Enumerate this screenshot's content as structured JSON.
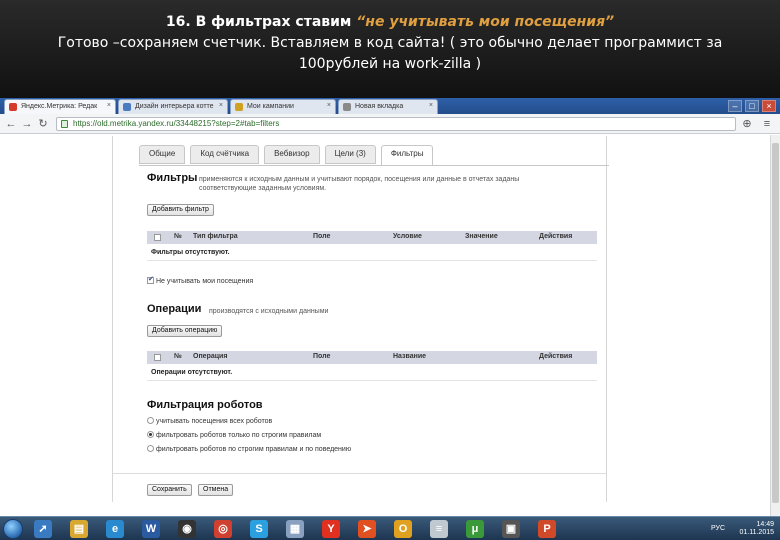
{
  "caption": {
    "line1_pre": "16. В  фильтрах ставим ",
    "line1_accent": "“не учитывать мои посещения”",
    "line2": "Готово –сохраняем счетчик. Вставляем в код сайта! ( это обычно делает программист за",
    "line3": "100рублей на work-zilla )"
  },
  "browser": {
    "tabs": [
      {
        "label": "Яндекс.Метрика: Редак",
        "color": "#d63a2a"
      },
      {
        "label": "Дизайн интерьера котте",
        "color": "#4a7ac0"
      },
      {
        "label": "Мои кампании",
        "color": "#d0a020"
      },
      {
        "label": "Новая вкладка",
        "color": "#8a8a8a"
      }
    ],
    "url": "https://old.metrika.yandex.ru/33448215?step=2#tab=filters",
    "window_buttons": {
      "minimize": "–",
      "maximize": "□",
      "close": "×"
    }
  },
  "page": {
    "tabs": [
      "Общие",
      "Код счётчика",
      "Вебвизор",
      "Цели (3)",
      "Фильтры"
    ],
    "active_tab": "Фильтры",
    "filters": {
      "title": "Фильтры",
      "desc": "применяются к исходным данным и учитывают порядок, посещения или данные в отчетах заданы соответствующие заданным условиям.",
      "add_button": "Добавить фильтр",
      "columns": [
        "№",
        "Тип фильтра",
        "Поле",
        "Условие",
        "Значение",
        "Действия"
      ],
      "empty": "Фильтры отсутствуют."
    },
    "ignore_visits": {
      "label": "Не учитывать мои посещения",
      "checked": true
    },
    "operations": {
      "title": "Операции",
      "desc": "производятся с исходными данными",
      "add_button": "Добавить операцию",
      "columns": [
        "№",
        "Операция",
        "Поле",
        "Название",
        "Действия"
      ],
      "empty": "Операции отсутствуют."
    },
    "robots": {
      "title": "Фильтрация роботов",
      "options": [
        {
          "label": "учитывать посещения всех роботов",
          "selected": false
        },
        {
          "label": "фильтровать роботов только по строгим правилам",
          "selected": true
        },
        {
          "label": "фильтровать роботов по строгим правилам и по поведению",
          "selected": false
        }
      ]
    },
    "save_button": "Сохранить",
    "cancel_button": "Отмена"
  },
  "taskbar": {
    "icons": [
      {
        "name": "rocket",
        "glyph": "➚",
        "color": "#3a7ac0"
      },
      {
        "name": "folder",
        "glyph": "▤",
        "color": "#d8a830"
      },
      {
        "name": "ie",
        "glyph": "e",
        "color": "#2a8ad0"
      },
      {
        "name": "word",
        "glyph": "W",
        "color": "#2a5aa0"
      },
      {
        "name": "media",
        "glyph": "◉",
        "color": "#333333"
      },
      {
        "name": "chrome",
        "glyph": "◎",
        "color": "#d04030"
      },
      {
        "name": "skype",
        "glyph": "S",
        "color": "#2aa0e0"
      },
      {
        "name": "notes",
        "glyph": "▦",
        "color": "#8aa0c0"
      },
      {
        "name": "yandex",
        "glyph": "Y",
        "color": "#e03020"
      },
      {
        "name": "arrow",
        "glyph": "➤",
        "color": "#e05020"
      },
      {
        "name": "outlook",
        "glyph": "O",
        "color": "#e0a020"
      },
      {
        "name": "text",
        "glyph": "≡",
        "color": "#c0c8d0"
      },
      {
        "name": "torrent",
        "glyph": "μ",
        "color": "#3a9a3a"
      },
      {
        "name": "video",
        "glyph": "▣",
        "color": "#555555"
      },
      {
        "name": "powerpoint",
        "glyph": "P",
        "color": "#d04a2a"
      }
    ],
    "lang": "РУС",
    "time": "14:49",
    "date": "01.11.2015"
  }
}
